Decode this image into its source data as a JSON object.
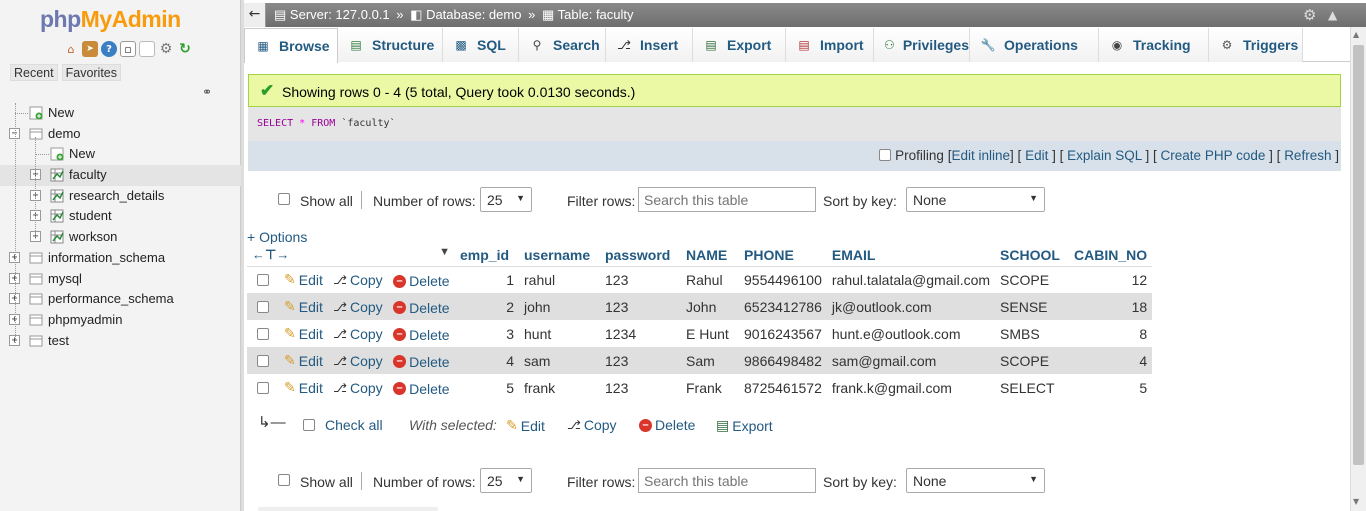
{
  "app": {
    "logo_php": "php",
    "logo_myadmin": "MyAdmin",
    "recent_tab": "Recent",
    "favorites_tab": "Favorites"
  },
  "tree": [
    {
      "label": "New",
      "level": 1,
      "icon": "new-icon"
    },
    {
      "label": "demo",
      "level": 0,
      "icon": "database-icon"
    },
    {
      "label": "New",
      "level": 2,
      "icon": "new-icon"
    },
    {
      "label": "faculty",
      "level": 1,
      "icon": "table-icon",
      "selected": true
    },
    {
      "label": "research_details",
      "level": 1,
      "icon": "table-icon"
    },
    {
      "label": "student",
      "level": 1,
      "icon": "table-icon"
    },
    {
      "label": "workson",
      "level": 1,
      "icon": "table-icon"
    },
    {
      "label": "information_schema",
      "level": 0,
      "icon": "database-icon"
    },
    {
      "label": "mysql",
      "level": 0,
      "icon": "database-icon"
    },
    {
      "label": "performance_schema",
      "level": 0,
      "icon": "database-icon"
    },
    {
      "label": "phpmyadmin",
      "level": 0,
      "icon": "database-icon"
    },
    {
      "label": "test",
      "level": 0,
      "icon": "database-icon"
    }
  ],
  "breadcrumb": {
    "server": "Server: 127.0.0.1",
    "database": "Database: demo",
    "table": "Table: faculty",
    "sep": "»"
  },
  "tabs": [
    {
      "label": "Browse",
      "icon": "browse-icon",
      "active": true
    },
    {
      "label": "Structure",
      "icon": "structure-icon"
    },
    {
      "label": "SQL",
      "icon": "sql-icon"
    },
    {
      "label": "Search",
      "icon": "search-icon"
    },
    {
      "label": "Insert",
      "icon": "insert-icon"
    },
    {
      "label": "Export",
      "icon": "export-icon"
    },
    {
      "label": "Import",
      "icon": "import-icon"
    },
    {
      "label": "Privileges",
      "icon": "privileges-icon"
    },
    {
      "label": "Operations",
      "icon": "operations-icon"
    },
    {
      "label": "Tracking",
      "icon": "tracking-icon"
    },
    {
      "label": "Triggers",
      "icon": "triggers-icon"
    }
  ],
  "result": {
    "message": "Showing rows 0 - 4 (5 total, Query took 0.0130 seconds.)",
    "sql_select": "SELECT",
    "sql_star": "*",
    "sql_from": "FROM",
    "sql_table": "`faculty`"
  },
  "profiling": {
    "label": "Profiling",
    "open": "[",
    "close": "]",
    "edit_inline": "Edit inline",
    "edit": "Edit",
    "explain": "Explain SQL",
    "php": "Create PHP code",
    "refresh": "Refresh"
  },
  "nav_controls": {
    "show_all": "Show all",
    "rows_label": "Number of rows:",
    "rows_value": "25",
    "filter_label": "Filter rows:",
    "filter_placeholder": "Search this table",
    "sort_label": "Sort by key:",
    "sort_value": "None"
  },
  "options_link": "+ Options",
  "columns": [
    "emp_id",
    "username",
    "password",
    "NAME",
    "PHONE",
    "EMAIL",
    "SCHOOL",
    "CABIN_NO"
  ],
  "row_actions": {
    "edit": "Edit",
    "copy": "Copy",
    "delete": "Delete"
  },
  "rows": [
    {
      "emp_id": "1",
      "username": "rahul",
      "password": "123",
      "NAME": "Rahul",
      "PHONE": "9554496100",
      "EMAIL": "rahul.talatala@gmail.com",
      "SCHOOL": "SCOPE",
      "CABIN_NO": "12"
    },
    {
      "emp_id": "2",
      "username": "john",
      "password": "123",
      "NAME": "John",
      "PHONE": "6523412786",
      "EMAIL": "jk@outlook.com",
      "SCHOOL": "SENSE",
      "CABIN_NO": "18"
    },
    {
      "emp_id": "3",
      "username": "hunt",
      "password": "1234",
      "NAME": "E Hunt",
      "PHONE": "9016243567",
      "EMAIL": "hunt.e@outlook.com",
      "SCHOOL": "SMBS",
      "CABIN_NO": "8"
    },
    {
      "emp_id": "4",
      "username": "sam",
      "password": "123",
      "NAME": "Sam",
      "PHONE": "9866498482",
      "EMAIL": "sam@gmail.com",
      "SCHOOL": "SCOPE",
      "CABIN_NO": "4"
    },
    {
      "emp_id": "5",
      "username": "frank",
      "password": "123",
      "NAME": "Frank",
      "PHONE": "8725461572",
      "EMAIL": "frank.k@gmail.com",
      "SCHOOL": "SELECT",
      "CABIN_NO": "5"
    }
  ],
  "bulk": {
    "check_all": "Check all",
    "with_selected": "With selected:",
    "edit": "Edit",
    "copy": "Copy",
    "delete": "Delete",
    "export": "Export"
  },
  "colors": {
    "link": "#235a81",
    "success_bg": "#ebf8a4",
    "logo_php": "#6c78af",
    "logo_myadmin": "#f89c0e"
  }
}
